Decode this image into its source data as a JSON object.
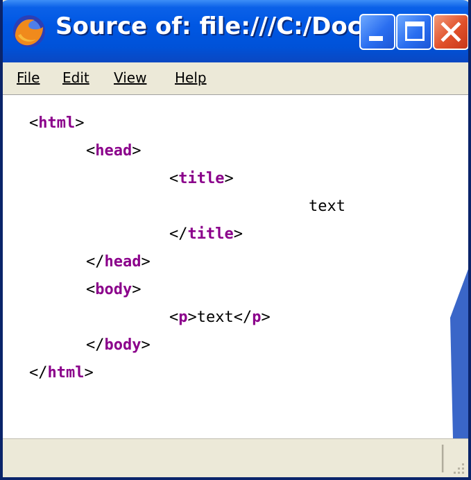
{
  "window": {
    "title": "Source of: file:///C:/Doc...",
    "app_icon": "firefox-icon"
  },
  "titlebar_buttons": {
    "minimize": "minimize-icon",
    "maximize": "maximize-icon",
    "close": "close-icon"
  },
  "menu": {
    "items": [
      {
        "label": "File"
      },
      {
        "label": "Edit"
      },
      {
        "label": "View"
      },
      {
        "label": "Help"
      }
    ]
  },
  "source": {
    "lines": [
      {
        "open": "<",
        "tag": "html",
        "close": ">"
      },
      {
        "open": "<",
        "tag": "head",
        "close": ">"
      },
      {
        "open": "<",
        "tag": "title",
        "close": ">"
      },
      {
        "text": "text"
      },
      {
        "open": "</",
        "tag": "title",
        "close": ">"
      },
      {
        "open": "</",
        "tag": "head",
        "close": ">"
      },
      {
        "open": "<",
        "tag": "body",
        "close": ">"
      },
      {
        "open": "<",
        "tag": "p",
        "mid": ">text</",
        "tag2": "p",
        "close": ">"
      },
      {
        "open": "</",
        "tag": "body",
        "close": ">"
      },
      {
        "open": "</",
        "tag": "html",
        "close": ">"
      }
    ]
  },
  "colors": {
    "titlebar": "#0054e3",
    "tag": "#8b008b",
    "close_button": "#e0502a",
    "chrome": "#ece9d8"
  }
}
